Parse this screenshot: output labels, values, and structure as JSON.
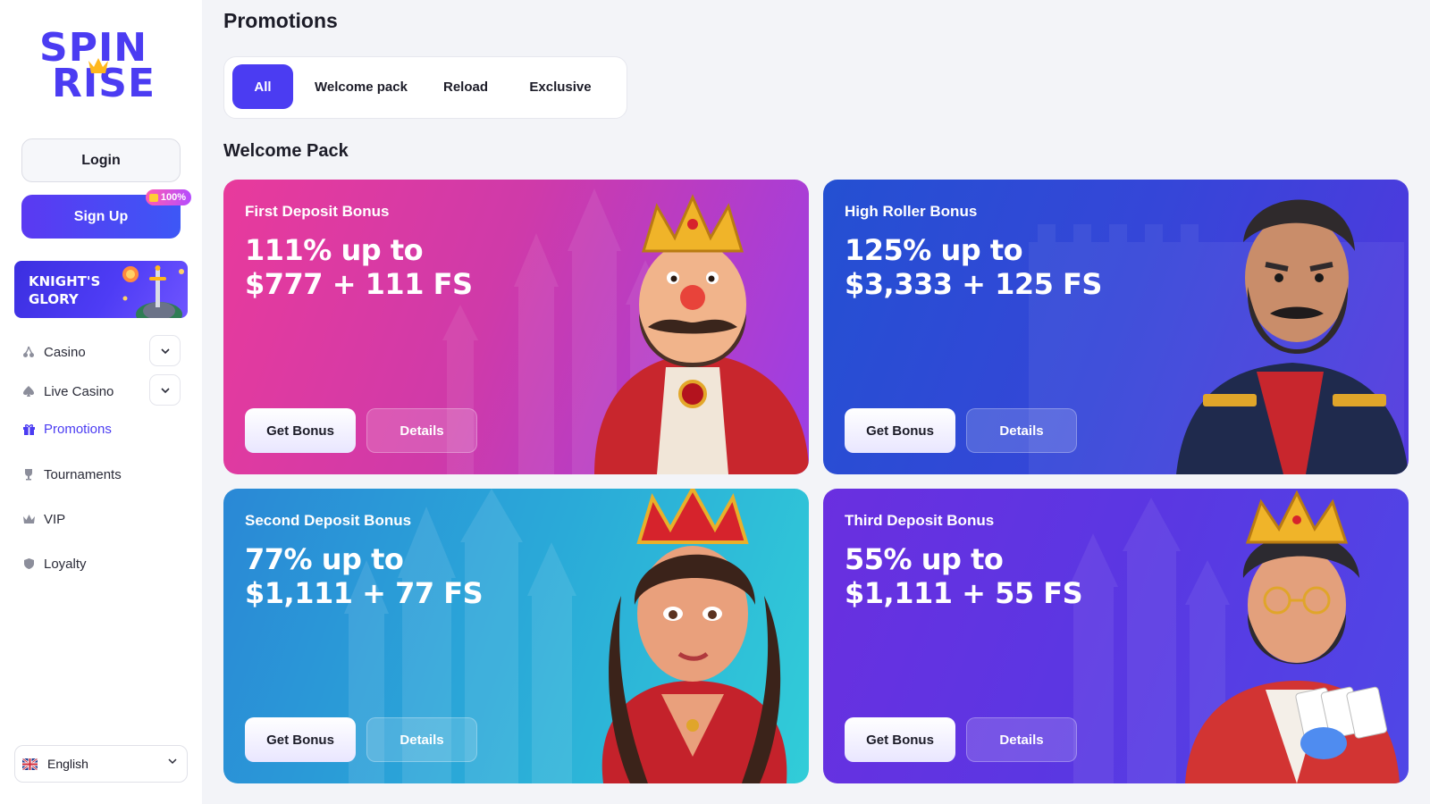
{
  "brand": {
    "logo_line1": "SPIN",
    "logo_line2": "RISE",
    "accent": "#4b3cf2"
  },
  "auth": {
    "login_label": "Login",
    "signup_label": "Sign Up",
    "signup_badge": "100%"
  },
  "promo_banner": {
    "line1": "KNIGHT'S",
    "line2": "GLORY"
  },
  "nav": [
    {
      "label": "Casino",
      "icon": "cherry-icon",
      "expandable": true
    },
    {
      "label": "Live Casino",
      "icon": "spade-icon",
      "expandable": true
    },
    {
      "label": "Promotions",
      "icon": "gift-icon",
      "active": true
    },
    {
      "label": "Tournaments",
      "icon": "trophy-icon"
    },
    {
      "label": "VIP",
      "icon": "crown-icon"
    },
    {
      "label": "Loyalty",
      "icon": "shield-icon"
    }
  ],
  "language": {
    "label": "English",
    "flag": "uk-flag-icon"
  },
  "page": {
    "title": "Promotions",
    "section_title": "Welcome Pack"
  },
  "tabs": [
    {
      "label": "All",
      "active": true
    },
    {
      "label": "Welcome pack"
    },
    {
      "label": "Reload"
    },
    {
      "label": "Exclusive"
    }
  ],
  "cards": [
    {
      "label": "First Deposit Bonus",
      "line1": "111% up to",
      "line2": "$777 + 111 FS",
      "get_label": "Get Bonus",
      "details_label": "Details",
      "colors": [
        "#e0359b",
        "#a43ee8"
      ]
    },
    {
      "label": "High Roller Bonus",
      "line1": "125% up to",
      "line2": "$3,333 + 125 FS",
      "get_label": "Get Bonus",
      "details_label": "Details",
      "colors": [
        "#2a4fd0",
        "#5338e0"
      ]
    },
    {
      "label": "Second Deposit Bonus",
      "line1": "77% up to",
      "line2": "$1,111 + 77 FS",
      "get_label": "Get Bonus",
      "details_label": "Details",
      "colors": [
        "#2a8fd8",
        "#2fc9d6"
      ]
    },
    {
      "label": "Third Deposit Bonus",
      "line1": "55% up to",
      "line2": "$1,111 + 55 FS",
      "get_label": "Get Bonus",
      "details_label": "Details",
      "colors": [
        "#6a2fe0",
        "#5a3fe8"
      ]
    }
  ]
}
